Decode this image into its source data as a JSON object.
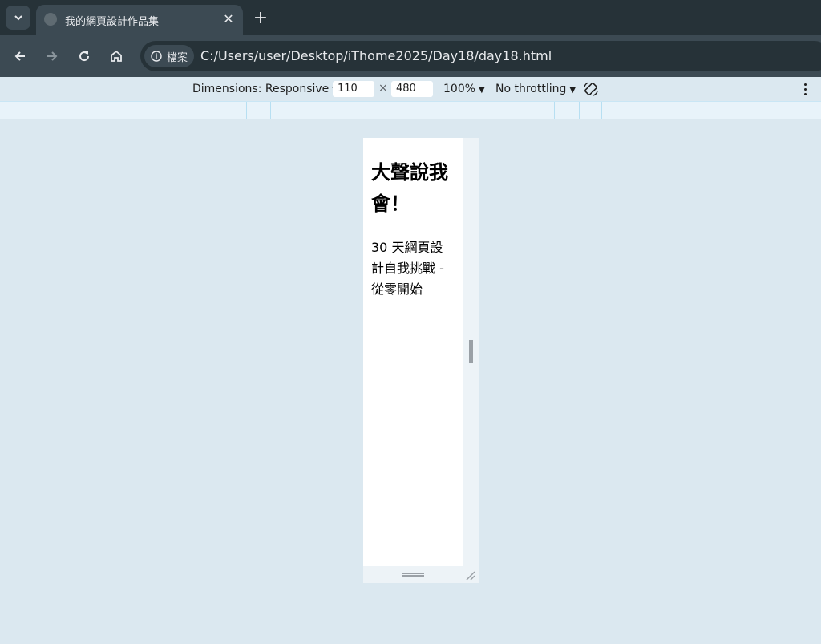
{
  "browser": {
    "tab": {
      "title": "我的網頁設計作品集",
      "close_glyph": "✕"
    },
    "new_tab_glyph": "+",
    "omnibox": {
      "chip_label": "檔案",
      "url": "C:/Users/user/Desktop/iThome2025/Day18/day18.html"
    }
  },
  "devtools": {
    "dimensions_label": "Dimensions: Responsive",
    "width_value": "110",
    "times_glyph": "×",
    "height_value": "480",
    "zoom_label": "100%",
    "throttle_label": "No throttling",
    "caret": "▼"
  },
  "page": {
    "heading": "大聲說我會！",
    "subtitle": "30 天網頁設計自我挑戰 - 從零開始"
  },
  "colors": {
    "tabstrip": "#263238",
    "toolbar": "#3c4a53",
    "canvas": "#dbe8f0",
    "viewport": "#ffffff"
  }
}
